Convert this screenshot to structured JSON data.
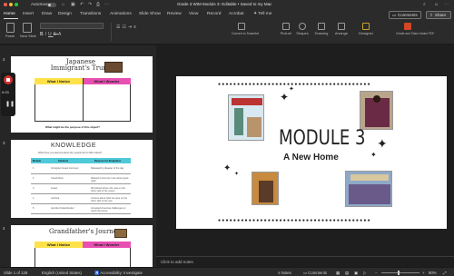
{
  "titlebar": {
    "autosave_label": "AutoSave",
    "doc_title": "Grade 3 WIM Module 3- Editable  •  Saved to my Mac",
    "icons": [
      "home-icon",
      "save-icon",
      "undo-icon",
      "redo-icon",
      "print-icon",
      "more-icon",
      "search-icon",
      "account-icon"
    ]
  },
  "tabs": [
    "Home",
    "Insert",
    "Draw",
    "Design",
    "Transitions",
    "Animations",
    "Slide Show",
    "Review",
    "View",
    "Record",
    "Acrobat",
    "Tell me"
  ],
  "header_buttons": {
    "comments": "Comments",
    "share": "Share"
  },
  "ribbon": {
    "paste": "Paste",
    "new_slide": "New Slide",
    "reset": "Reset",
    "layout": "Layout",
    "section": "Section",
    "convert": "Convert to SmartArt",
    "picture": "Picture",
    "shapes": "Shapes",
    "drawing": "Drawing",
    "arrange": "Arrange",
    "designer": "Designer",
    "dictate": "Dictate",
    "add_ins": "Add-ins",
    "create_pdf": "Create and Share Adobe PDF"
  },
  "recording": {
    "time": "0:03"
  },
  "slides": [
    {
      "number": "2",
      "title": "Japanese Immigrant's Trunk",
      "col_left": "What I Notice",
      "col_right": "What I Wonder",
      "question": "What might be the purpose of this object?",
      "colors": {
        "left": "#ffe24a",
        "right": "#e84fb3"
      }
    },
    {
      "number": "3",
      "title": "KNOWLEDGE",
      "prompt": "What have you learned about why people left for Ellis Island?",
      "headers": [
        "Module",
        "Students",
        "Reasons for Emigration"
      ],
      "rows": [
        [
          "1",
          "Immigrant Guest Journeys",
          "Released by disaster of the day"
        ],
        [
          "2",
          "Cloud Moon",
          "Wanted to find out more about good night"
        ],
        [
          "3",
          "Imaan",
          "Wondered where she was on the other side of the ocean"
        ],
        [
          "4",
          "Gorbina",
          "Curious about what he sees on the other side of the sea"
        ],
        [
          "5",
          "Aemilia Knickerbocker",
          "Accepted Americas challenges to reach the Home"
        ]
      ],
      "colors": {
        "header": "#4fc9d9"
      }
    },
    {
      "number": "4",
      "title": "Grandfather's Journey",
      "col_left": "What I Notice",
      "col_right": "What I Wonder",
      "colors": {
        "left": "#ffe24a",
        "right": "#e84fb3"
      }
    }
  ],
  "main_slide": {
    "title": "MODULE 3",
    "subtitle": "A New Home",
    "books": [
      "coming-to-america-cover",
      "tea-with-milk-cover",
      "girl-portrait-cover",
      "people-crowd-cover"
    ]
  },
  "notes_placeholder": "Click to add notes",
  "status": {
    "slide_counter": "Slide 1 of 128",
    "language": "English (United States)",
    "accessibility": "Accessibility: Investigate",
    "notes": "Notes",
    "comments": "Comments",
    "zoom": "90%"
  },
  "colors": {
    "accent": "#d24726",
    "ribbon_bg": "#2b2b2b",
    "canvas_bg": "#1e1e1e"
  }
}
